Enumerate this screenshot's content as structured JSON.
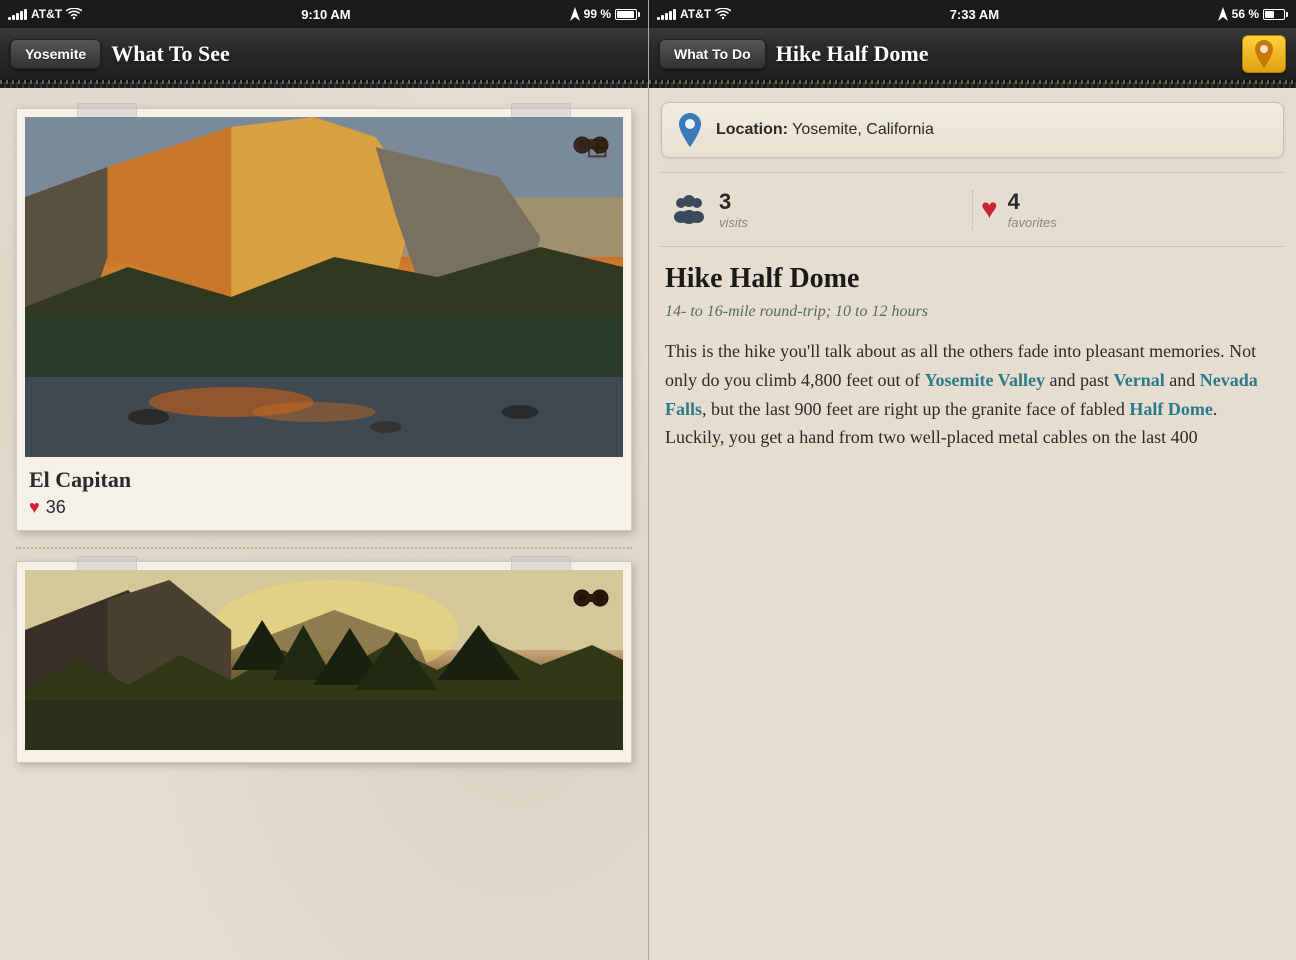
{
  "left": {
    "status": {
      "carrier": "AT&T",
      "time": "9:10 AM",
      "battery_pct": "99 %",
      "signal_bars": [
        3,
        5,
        7,
        9,
        11
      ],
      "wifi": true
    },
    "nav": {
      "back_label": "Yosemite",
      "title": "What To See"
    },
    "cards": [
      {
        "id": "el-capitan",
        "title": "El Capitan",
        "favorites": 36,
        "has_binoculars": true
      },
      {
        "id": "half-dome-valley",
        "title": "",
        "favorites": null,
        "has_binoculars": true
      }
    ]
  },
  "right": {
    "status": {
      "carrier": "AT&T",
      "time": "7:33 AM",
      "battery_pct": "56 %",
      "signal_bars": [
        3,
        5,
        7,
        9,
        11
      ],
      "wifi": true
    },
    "nav": {
      "back_label": "What To Do",
      "title": "Hike Half Dome",
      "has_location_btn": true
    },
    "location": {
      "label": "Location:",
      "value": "Yosemite, California"
    },
    "stats": {
      "visits": {
        "count": "3",
        "label": "visits"
      },
      "favorites": {
        "count": "4",
        "label": "favorites"
      }
    },
    "article": {
      "title": "Hike Half Dome",
      "subtitle": "14- to 16-mile round-trip; 10 to 12 hours",
      "body_parts": [
        "This is the hike you'll talk about as all the others fade into pleasant memories. Not only do you climb 4,800 feet out of ",
        "Yosemite Valley",
        " and past ",
        "Vernal",
        " and ",
        "Nevada Falls",
        ", but the last 900 feet are right up the granite face of fabled ",
        "Half Dome",
        ". Luckily, you get a hand from two well-placed metal cables on the last 400"
      ]
    }
  }
}
